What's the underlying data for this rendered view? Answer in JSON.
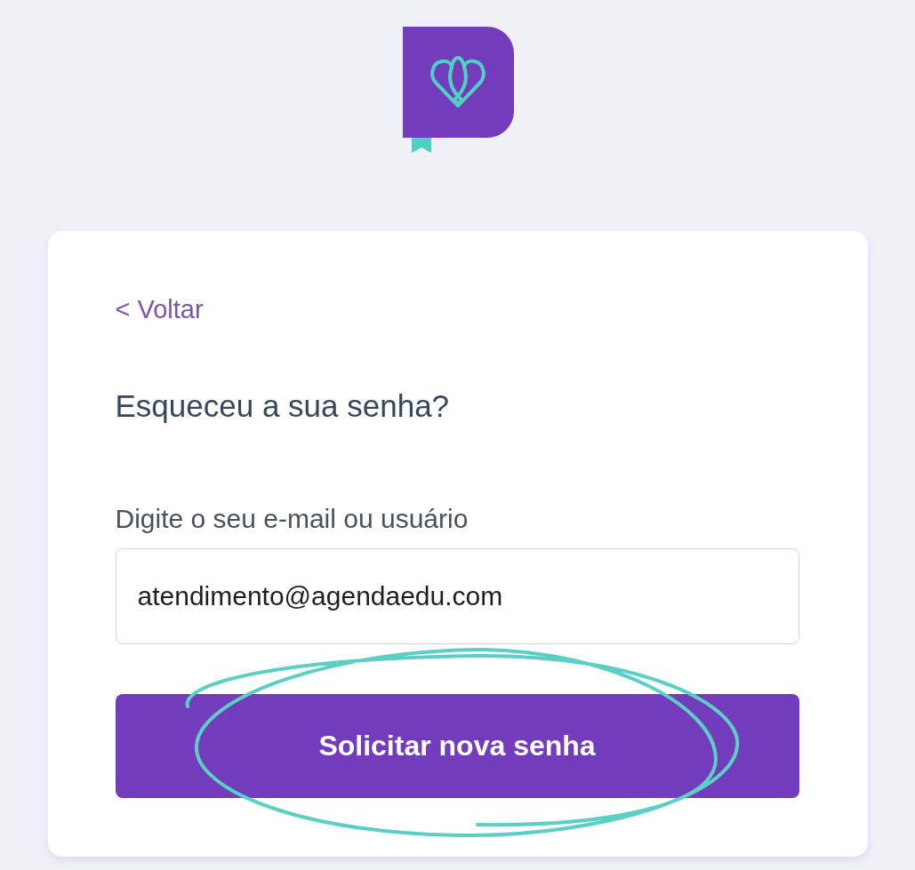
{
  "back_link": {
    "label": "< Voltar"
  },
  "title": "Esqueceu a sua senha?",
  "email_field": {
    "label": "Digite o seu e-mail ou usuário",
    "value": "atendimento@agendaedu.com"
  },
  "submit_button": {
    "label": "Solicitar nova senha"
  }
}
